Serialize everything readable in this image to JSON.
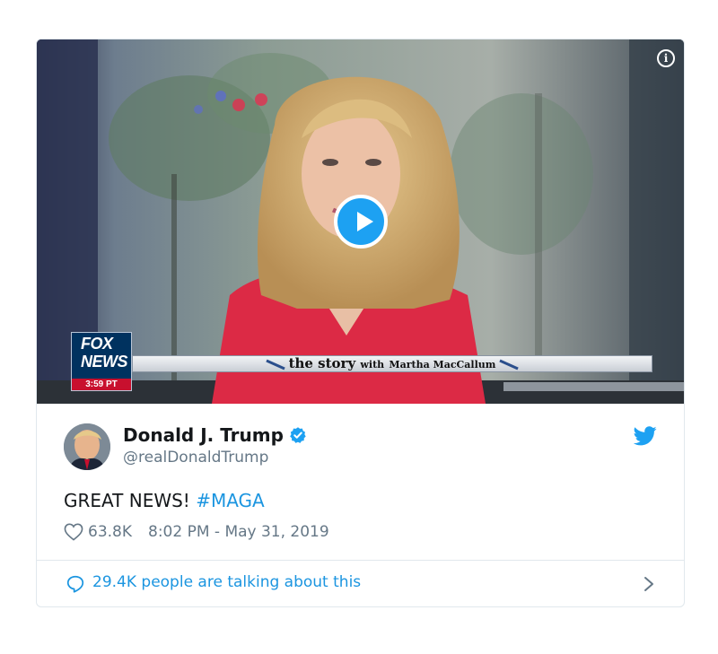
{
  "video": {
    "network_logo_line1": "FOX",
    "network_logo_line2": "NEWS",
    "network_time": "3:59 PT",
    "show_title": "the story",
    "show_with": "with",
    "show_host": "Martha MacCallum",
    "info_icon": "info-icon",
    "play_icon": "play-icon"
  },
  "tweet": {
    "display_name": "Donald J. Trump",
    "handle": "@realDonaldTrump",
    "verified_icon": "verified-badge-icon",
    "platform_icon": "twitter-bird-icon",
    "text_prefix": "GREAT NEWS! ",
    "hashtag": "#MAGA",
    "likes": "63.8K",
    "timestamp": "8:02 PM - May 31, 2019",
    "talking_text": "29.4K people are talking about this"
  },
  "colors": {
    "accent": "#1da1f2",
    "link": "#1b95e0",
    "text": "#14171a",
    "secondary_text": "#657786",
    "border": "#e1e8ed"
  }
}
